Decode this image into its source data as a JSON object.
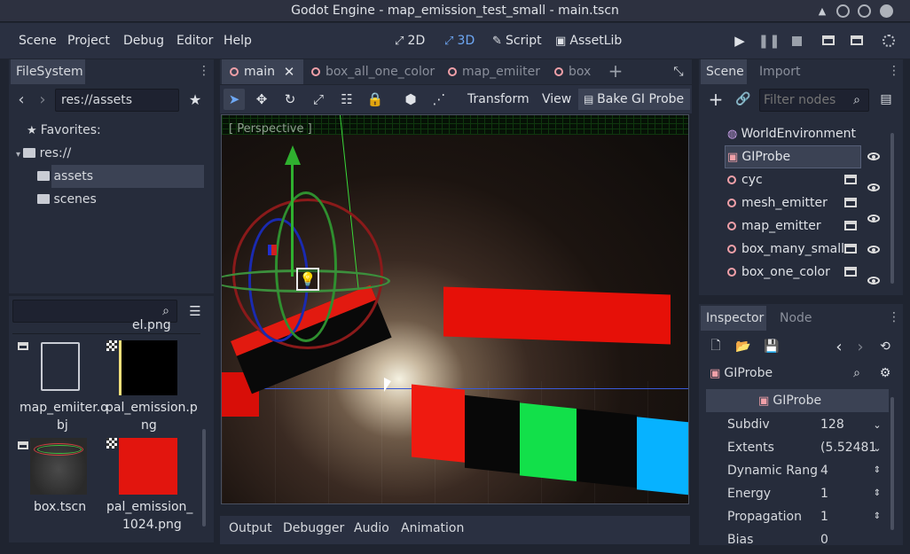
{
  "window": {
    "title": "Godot Engine - map_emission_test_small - main.tscn"
  },
  "menubar": {
    "items": [
      "Scene",
      "Project",
      "Debug",
      "Editor",
      "Help"
    ],
    "modes": [
      {
        "label": "2D",
        "icon": "2d-icon"
      },
      {
        "label": "3D",
        "icon": "3d-icon"
      },
      {
        "label": "Script",
        "icon": "script-icon"
      },
      {
        "label": "AssetLib",
        "icon": "assetlib-icon"
      }
    ],
    "active_mode": "3D"
  },
  "filesystem": {
    "tab": "FileSystem",
    "path": "res://assets",
    "favorites_label": "Favorites:",
    "tree": [
      "res://",
      "assets",
      "scenes"
    ],
    "files": [
      {
        "name": "el.png",
        "partial": true
      },
      {
        "name": "map_emiiter.obj"
      },
      {
        "name": "pal_emission.png"
      },
      {
        "name": "box.tscn"
      },
      {
        "name": "pal_emission_1024.png"
      }
    ],
    "file_labels": {
      "partial": "el.png",
      "f1a": "map_emiiter.o",
      "f1b": "bj",
      "f2a": "pal_emission.p",
      "f2b": "ng",
      "f3": "box.tscn",
      "f4a": "pal_emission_",
      "f4b": "1024.png"
    }
  },
  "editor_tabs": [
    "main",
    "box_all_one_color",
    "map_emiiter",
    "box"
  ],
  "viewport_toolbar": {
    "transform": "Transform",
    "view": "View",
    "bake": "Bake GI Probe",
    "perspective": "[ Perspective ]"
  },
  "bottom_tabs": [
    "Output",
    "Debugger",
    "Audio",
    "Animation"
  ],
  "scene_panel": {
    "tabs": [
      "Scene",
      "Import"
    ],
    "filter_placeholder": "Filter nodes",
    "nodes": [
      "WorldEnvironment",
      "GIProbe",
      "cyc",
      "mesh_emitter",
      "map_emitter",
      "box_many_small",
      "box_one_color"
    ],
    "selected": "GIProbe"
  },
  "inspector": {
    "tabs": [
      "Inspector",
      "Node"
    ],
    "object": "GIProbe",
    "section": "GIProbe",
    "props": [
      {
        "name": "Subdiv",
        "value": "128"
      },
      {
        "name": "Extents",
        "value": "(5.52481"
      },
      {
        "name": "Dynamic Rang",
        "value": "4"
      },
      {
        "name": "Energy",
        "value": "1"
      },
      {
        "name": "Propagation",
        "value": "1"
      },
      {
        "name": "Bias",
        "value": "0"
      }
    ]
  },
  "colors": {
    "accent": "#6ea8f5",
    "node_icon": "#f0a0a8",
    "bg": "#1f2430",
    "panel": "#262c3b"
  }
}
